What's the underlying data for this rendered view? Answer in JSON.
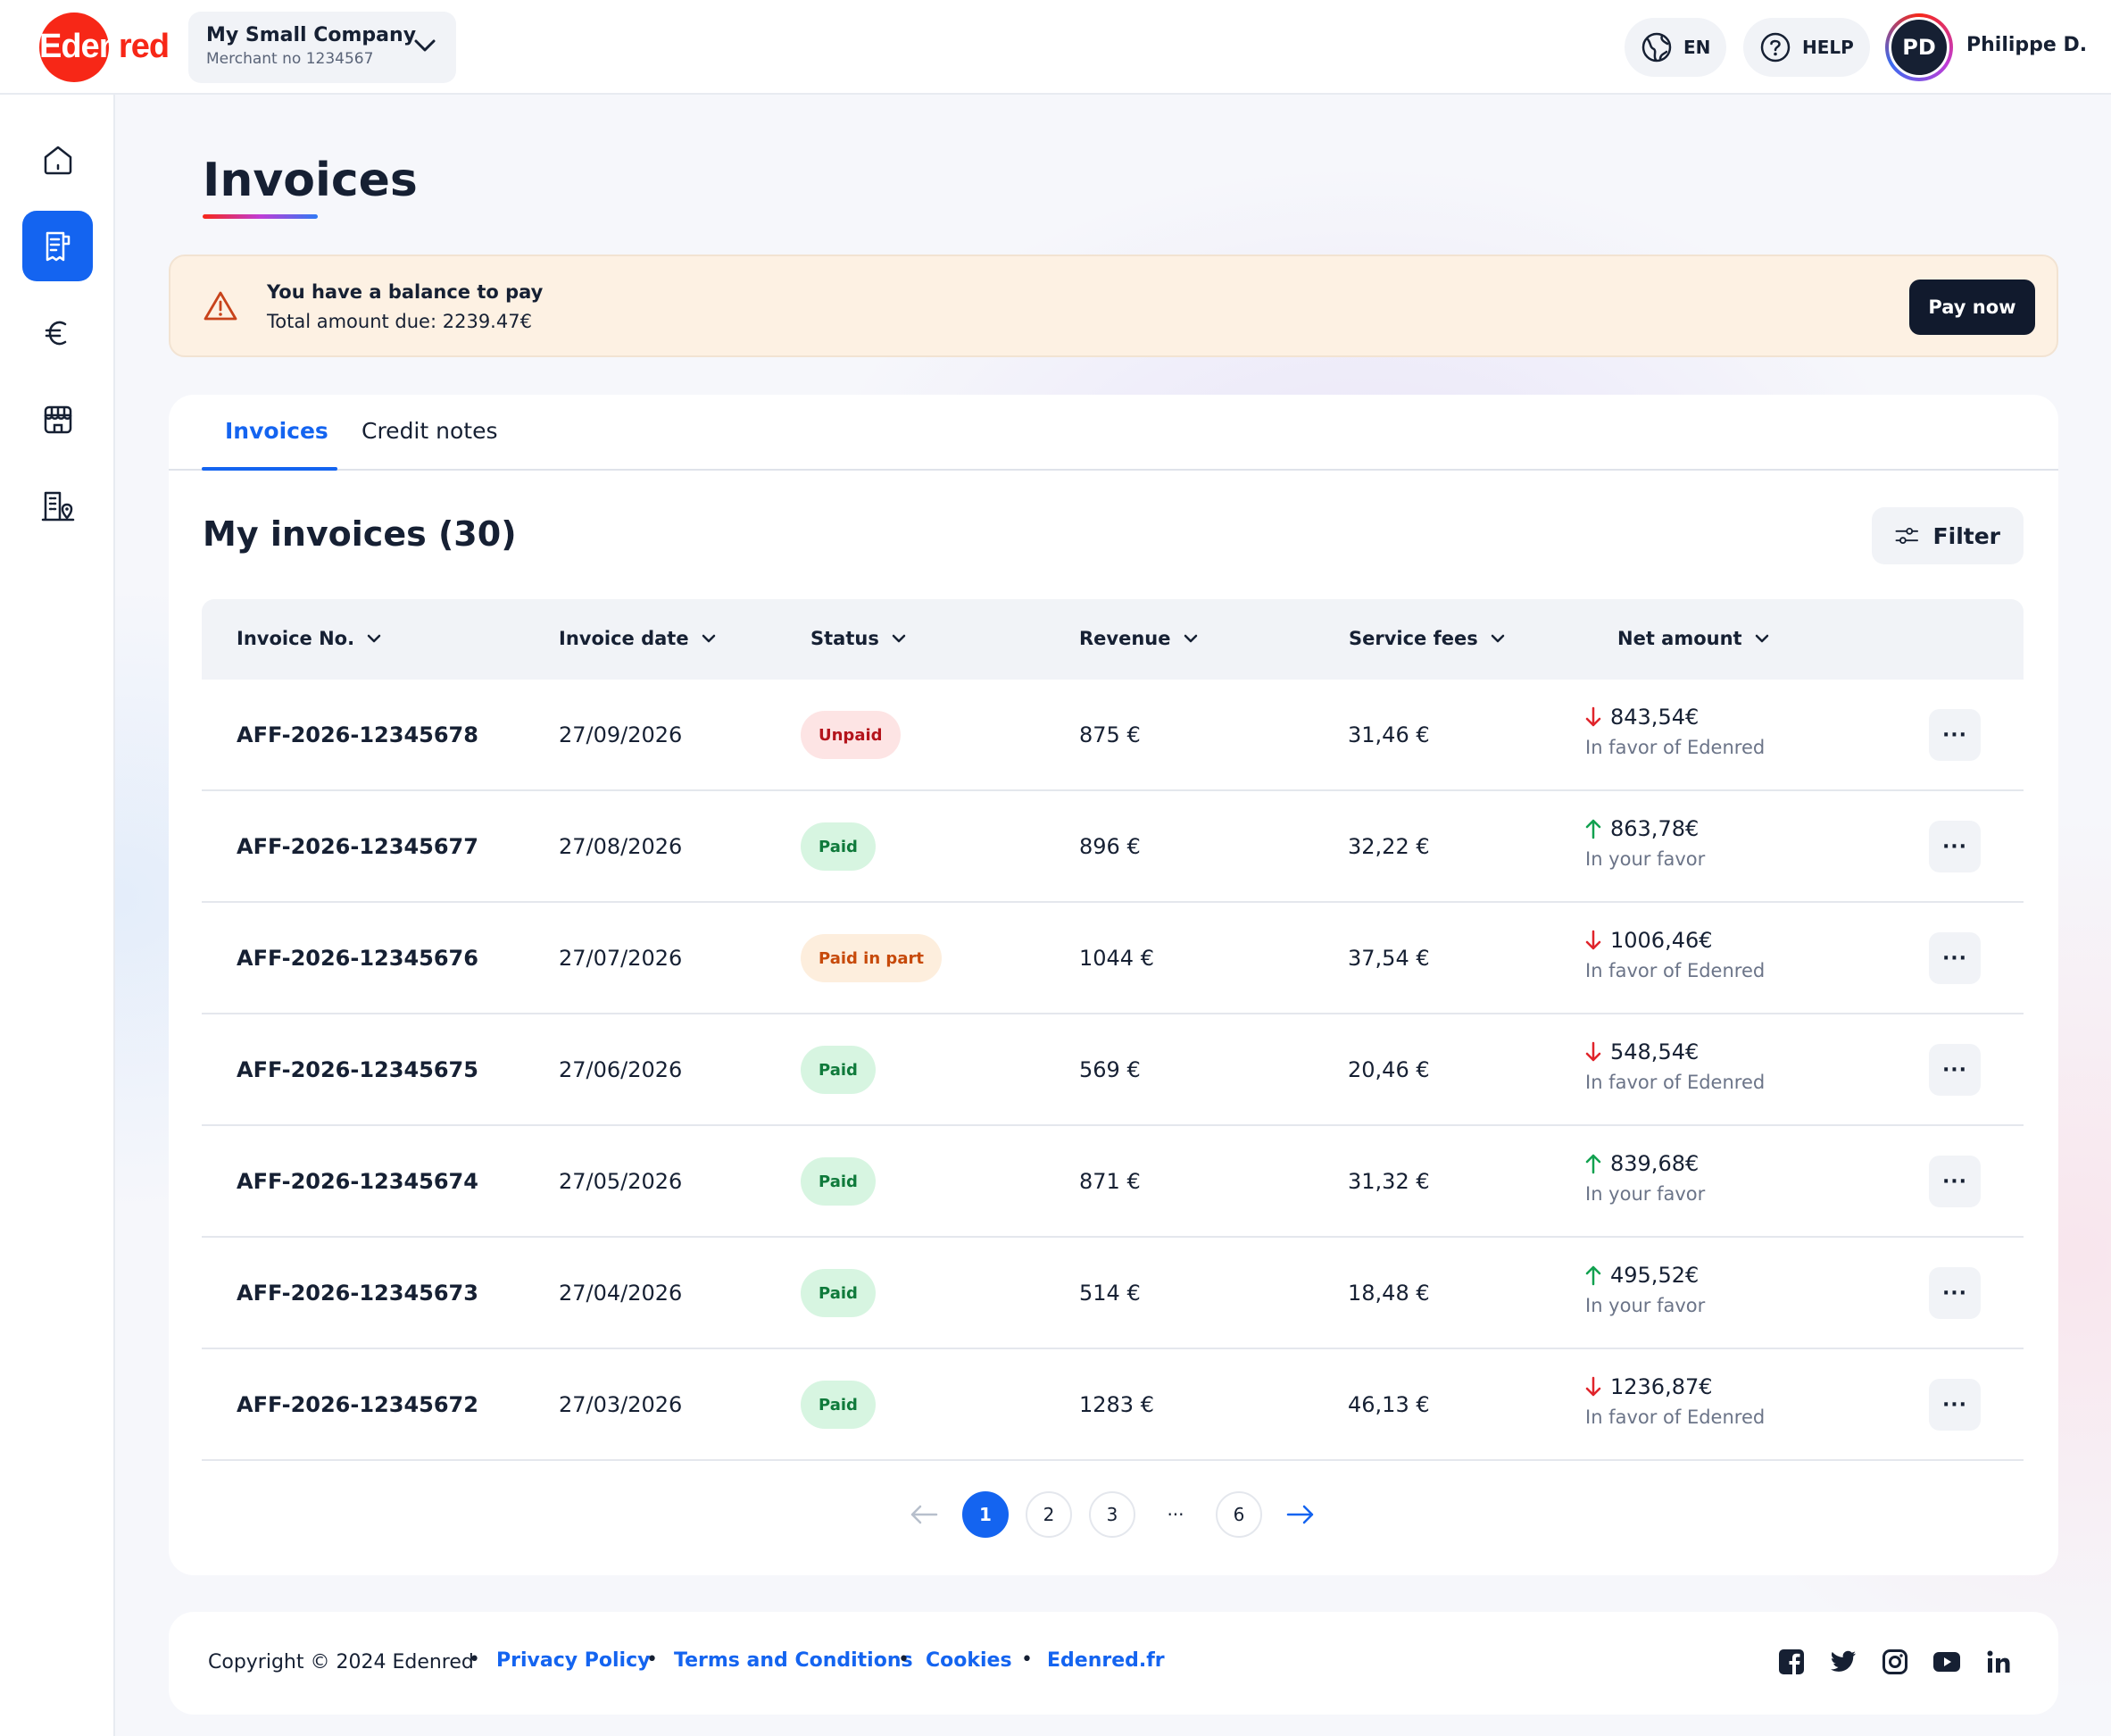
{
  "brand": {
    "logo_text_white": "Eden",
    "logo_text_red": "red",
    "accent": "#f72717",
    "primary": "#1464f0"
  },
  "header": {
    "company_name": "My Small Company",
    "merchant": "Merchant no 1234567",
    "language": "EN",
    "help": "HELP",
    "avatar_initials": "PD",
    "user_name": "Philippe D."
  },
  "sidebar": {
    "items": [
      {
        "icon": "home-icon",
        "active": false
      },
      {
        "icon": "invoice-icon",
        "active": true
      },
      {
        "icon": "euro-icon",
        "active": false
      },
      {
        "icon": "store-icon",
        "active": false
      },
      {
        "icon": "building-location-icon",
        "active": false
      }
    ]
  },
  "page": {
    "title": "Invoices"
  },
  "alert": {
    "title": "You have a balance to pay",
    "subtitle": "Total amount due: 2239.47€",
    "button": "Pay now"
  },
  "tabs": [
    {
      "label": "Invoices",
      "active": true
    },
    {
      "label": "Credit notes",
      "active": false
    }
  ],
  "list": {
    "title": "My invoices (30)",
    "filter_label": "Filter",
    "columns": [
      "Invoice No.",
      "Invoice date",
      "Status",
      "Revenue",
      "Service fees",
      "Net amount"
    ],
    "rows": [
      {
        "invoice": "AFF-2026-12345678",
        "date": "27/09/2026",
        "status": "Unpaid",
        "status_type": "unpaid",
        "revenue": "875 €",
        "fees": "31,46 €",
        "net": "843,54€",
        "direction": "down",
        "net_note": "In favor of Edenred"
      },
      {
        "invoice": "AFF-2026-12345677",
        "date": "27/08/2026",
        "status": "Paid",
        "status_type": "paid",
        "revenue": "896 €",
        "fees": "32,22 €",
        "net": "863,78€",
        "direction": "up",
        "net_note": "In your favor"
      },
      {
        "invoice": "AFF-2026-12345676",
        "date": "27/07/2026",
        "status": "Paid in part",
        "status_type": "part",
        "revenue": "1044 €",
        "fees": "37,54 €",
        "net": "1006,46€",
        "direction": "down",
        "net_note": "In favor of Edenred"
      },
      {
        "invoice": "AFF-2026-12345675",
        "date": "27/06/2026",
        "status": "Paid",
        "status_type": "paid",
        "revenue": "569 €",
        "fees": "20,46 €",
        "net": "548,54€",
        "direction": "down",
        "net_note": "In favor of Edenred"
      },
      {
        "invoice": "AFF-2026-12345674",
        "date": "27/05/2026",
        "status": "Paid",
        "status_type": "paid",
        "revenue": "871 €",
        "fees": "31,32 €",
        "net": "839,68€",
        "direction": "up",
        "net_note": "In your favor"
      },
      {
        "invoice": "AFF-2026-12345673",
        "date": "27/04/2026",
        "status": "Paid",
        "status_type": "paid",
        "revenue": "514 €",
        "fees": "18,48 €",
        "net": "495,52€",
        "direction": "up",
        "net_note": "In your favor"
      },
      {
        "invoice": "AFF-2026-12345672",
        "date": "27/03/2026",
        "status": "Paid",
        "status_type": "paid",
        "revenue": "1283 €",
        "fees": "46,13 €",
        "net": "1236,87€",
        "direction": "down",
        "net_note": "In favor of Edenred"
      }
    ],
    "row_menu_label": "···"
  },
  "pagination": {
    "pages": [
      "1",
      "2",
      "3",
      "···",
      "6"
    ],
    "current": "1"
  },
  "footer": {
    "copyright": "Copyright © 2024 Edenred",
    "links": [
      "Privacy Policy",
      "Terms and Conditions",
      "Cookies",
      "Edenred.fr"
    ],
    "social": [
      "facebook-icon",
      "twitter-icon",
      "instagram-icon",
      "youtube-icon",
      "linkedin-icon"
    ]
  },
  "colors": {
    "down_arrow": "#e0242b",
    "up_arrow": "#12a150"
  }
}
